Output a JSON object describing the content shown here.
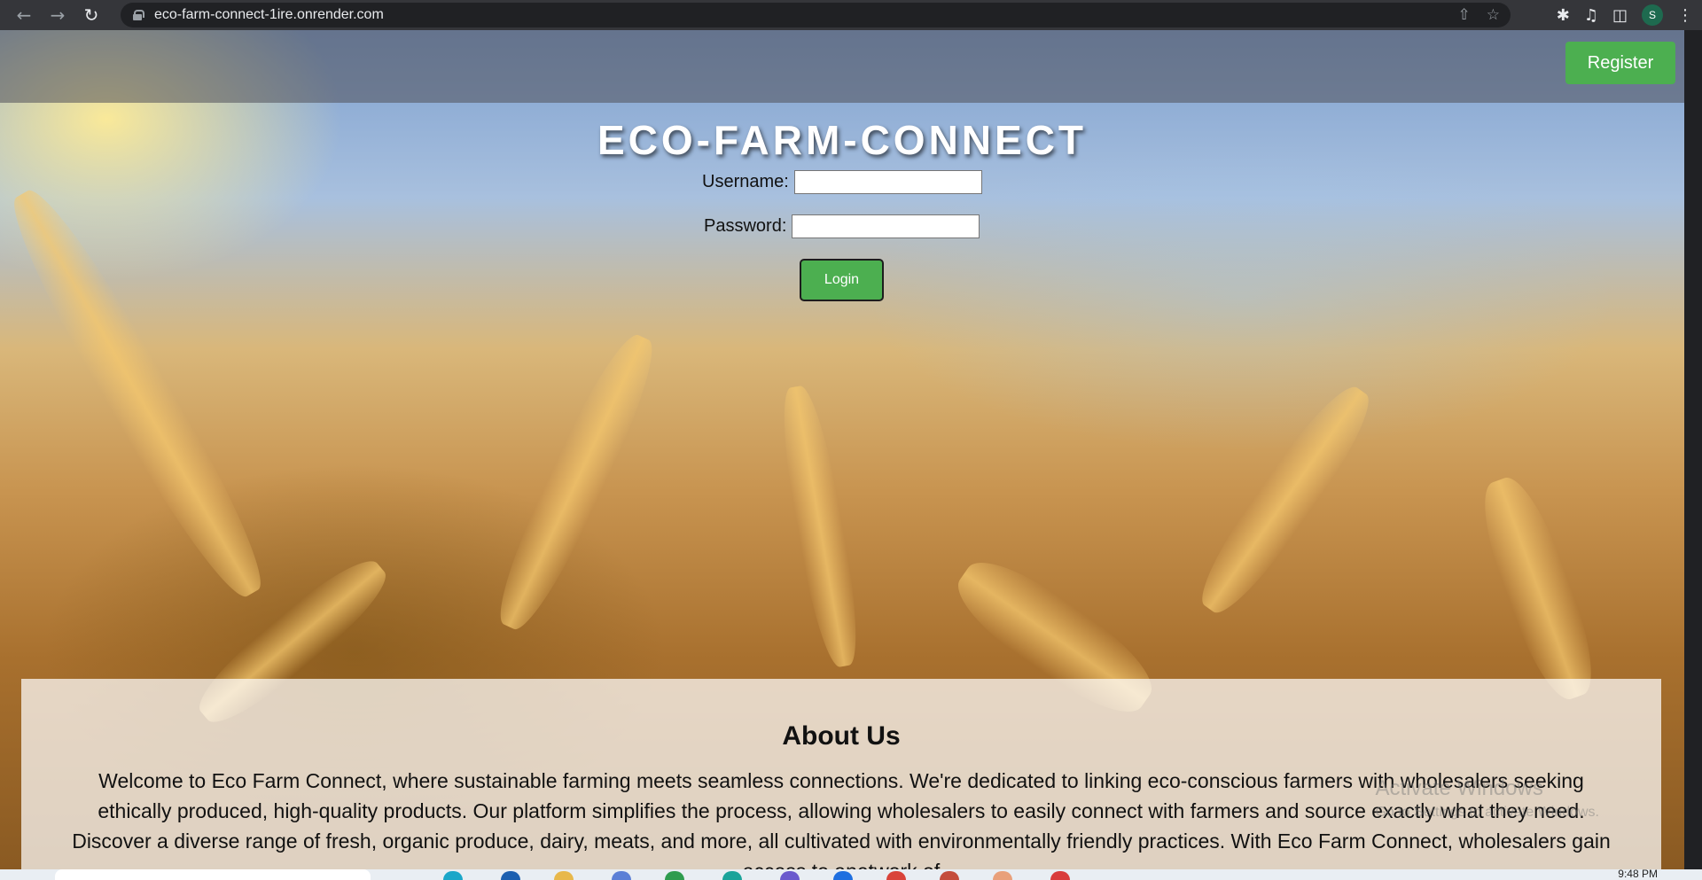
{
  "browser": {
    "url": "eco-farm-connect-1ire.onrender.com",
    "profile_initial": "S",
    "icons": [
      "back-icon",
      "forward-icon",
      "reload-icon",
      "lock-icon",
      "share-icon",
      "star-icon",
      "extensions-icon",
      "media-icon",
      "side-panel-icon",
      "menu-icon"
    ]
  },
  "header": {
    "register_label": "Register"
  },
  "site": {
    "title": "ECO-FARM-CONNECT"
  },
  "login_form": {
    "username_label": "Username:",
    "username_value": "",
    "password_label": "Password:",
    "password_value": "",
    "login_label": "Login"
  },
  "about": {
    "heading": "About Us",
    "body": "Welcome to Eco Farm Connect, where sustainable farming meets seamless connections. We're dedicated to linking eco-conscious farmers with wholesalers seeking ethically produced, high-quality products. Our platform simplifies the process, allowing wholesalers to easily connect with farmers and source exactly what they need. Discover a diverse range of fresh, organic produce, dairy, meats, and more, all cultivated with environmentally friendly practices. With Eco Farm Connect, wholesalers gain access to anetwork of"
  },
  "overlay": {
    "activate_title": "Activate Windows",
    "activate_sub": "Go to Settings to activate Windows."
  },
  "taskbar": {
    "time": "9:48 PM"
  },
  "colors": {
    "accent_green": "#4caf50",
    "chrome_dark": "#35363a"
  }
}
